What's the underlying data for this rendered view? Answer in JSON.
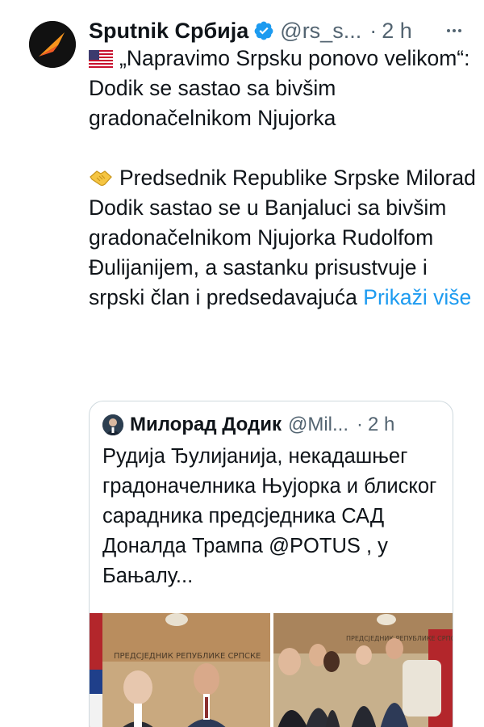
{
  "tweet": {
    "author": {
      "display_name": "Sputnik Србија",
      "handle": "@rs_s...",
      "verified": true,
      "avatar_icon": "sputnik-logo-icon"
    },
    "time": "2 h",
    "text": {
      "headline": "„Napravimo Srpsku ponovo velikom“: Dodik se sastao sa bivšim gradonačelnikom Njujorka",
      "headline_icon": "us-flag-icon",
      "body": "Predsednik Republike Srpske Milorad Dodik sastao se u Banjaluci sa bivšim gradonačelnikom Njujorka Rudolfom Đulijanijem, a sastanku prisustvuje i srpski član i predsedavajuća",
      "body_icon": "handshake-icon",
      "show_more": "Prikaži više"
    }
  },
  "quoted_tweet": {
    "author": {
      "display_name": "Милорад Додик",
      "handle": "@Mil...",
      "avatar_icon": "user-avatar-icon"
    },
    "time": "2 h",
    "text": "Рудија Ђулијанија, некадашњег градоначелника Њујорка и блиског сарадника предсједника САД Доналда Трампа @POTUS , у Бањалу...",
    "photos": [
      {
        "name": "meeting-photo-1",
        "banner": "ПРЕДСЈЕДНИК РЕПУБЛИКЕ СРПСКЕ"
      },
      {
        "name": "meeting-photo-2",
        "banner": "ПРЕДСЈЕДНИК РЕПУБЛИКЕ СРПСКЕ"
      }
    ]
  },
  "colors": {
    "text": "#0f1419",
    "secondary": "#536471",
    "link": "#1d9bf0",
    "verified": "#1d9bf0",
    "border": "#cfd9de"
  }
}
